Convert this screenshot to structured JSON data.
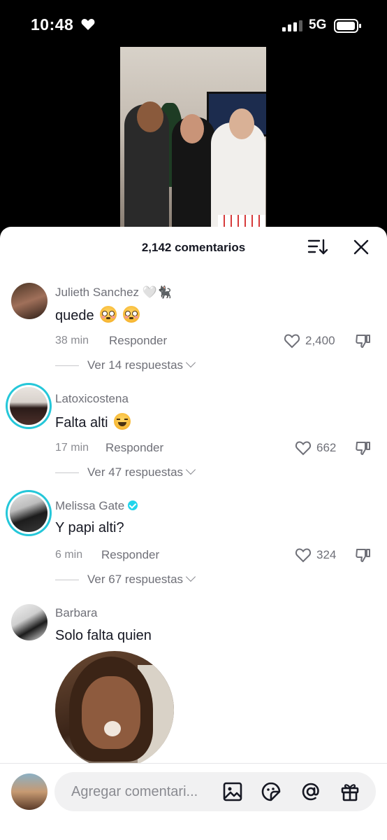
{
  "status_bar": {
    "time": "10:48",
    "network": "5G"
  },
  "comments_header": {
    "count_label": "2,142 comentarios"
  },
  "comments": [
    {
      "username": "Julieth Sanchez 🤍🐈‍⬛",
      "text": "quede",
      "time": "38 min",
      "reply_label": "Responder",
      "likes": "2,400",
      "view_replies": "Ver 14 respuestas"
    },
    {
      "username": "Latoxicostena",
      "text": "Falta alti",
      "time": "17 min",
      "reply_label": "Responder",
      "likes": "662",
      "view_replies": "Ver 47 respuestas"
    },
    {
      "username": "Melissa Gate",
      "text": "Y papi alti?",
      "time": "6 min",
      "reply_label": "Responder",
      "likes": "324",
      "view_replies": "Ver 67 respuestas"
    },
    {
      "username": "Barbara",
      "text": "Solo falta quien"
    }
  ],
  "input_bar": {
    "placeholder": "Agregar comentari..."
  },
  "colors": {
    "story_ring": "#25c7d9",
    "verified": "#20d5ec",
    "text_primary": "#161823",
    "text_secondary": "#6f7078"
  },
  "icons": [
    "heart-icon",
    "signal-icon",
    "battery-icon",
    "sort-icon",
    "close-icon",
    "like-icon",
    "dislike-icon",
    "chevron-down-icon",
    "verified-icon",
    "image-icon",
    "sticker-icon",
    "mention-icon",
    "gift-icon"
  ]
}
